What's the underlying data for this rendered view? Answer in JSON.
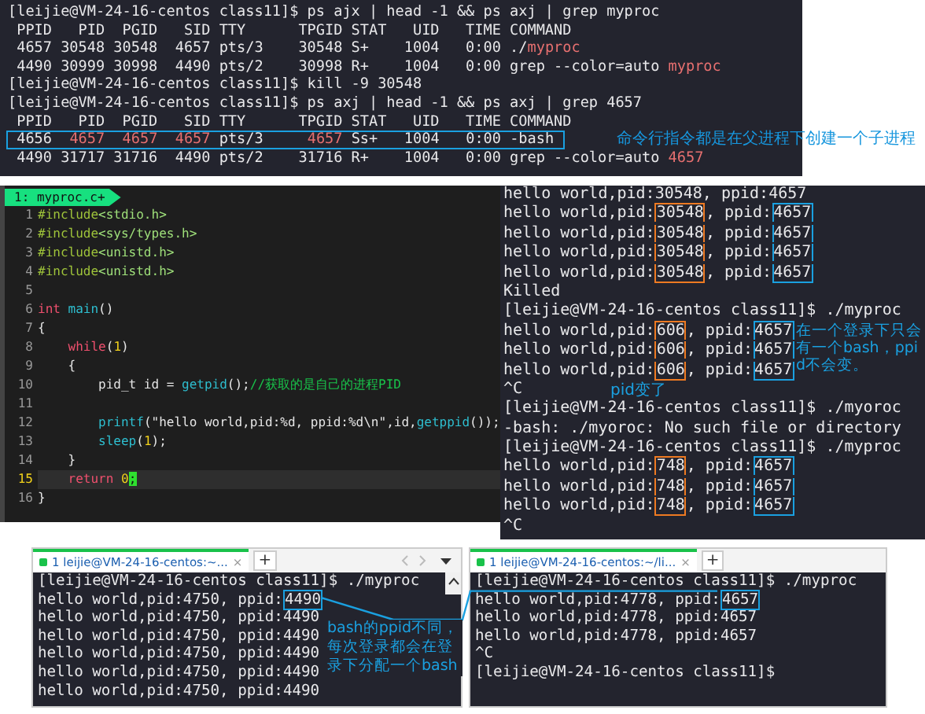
{
  "top_terminal": {
    "lines": [
      {
        "highlighted": false,
        "segments": [
          {
            "text": "[leijie@VM-24-16-centos class11]$ ps ajx | head -1 && ps axj | grep myproc",
            "kind": "plain"
          }
        ]
      },
      {
        "highlighted": false,
        "segments": [
          {
            "text": " PPID   PID  PGID   SID TTY      TPGID STAT   UID   TIME COMMAND",
            "kind": "plain"
          }
        ]
      },
      {
        "highlighted": false,
        "segments": [
          {
            "text": " 4657 30548 30548  4657 pts/3    30548 S+    1004   0:00 ./",
            "kind": "plain"
          },
          {
            "text": "myproc",
            "kind": "match"
          }
        ]
      },
      {
        "highlighted": false,
        "segments": [
          {
            "text": " 4490 30999 30998  4490 pts/2    30998 R+    1004   0:00 grep --color=auto ",
            "kind": "plain"
          },
          {
            "text": "myproc",
            "kind": "match"
          }
        ]
      },
      {
        "highlighted": false,
        "segments": [
          {
            "text": "[leijie@VM-24-16-centos class11]$ kill -9 30548",
            "kind": "plain"
          }
        ]
      },
      {
        "highlighted": false,
        "segments": [
          {
            "text": "[leijie@VM-24-16-centos class11]$ ps axj | head -1 && ps axj | grep 4657",
            "kind": "plain"
          }
        ]
      },
      {
        "highlighted": false,
        "segments": [
          {
            "text": " PPID   PID  PGID   SID TTY      TPGID STAT   UID   TIME COMMAND",
            "kind": "plain"
          }
        ]
      },
      {
        "highlighted": true,
        "segments": [
          {
            "text": " 4656  ",
            "kind": "plain"
          },
          {
            "text": "4657",
            "kind": "match"
          },
          {
            "text": "  4657",
            "kind": "match"
          },
          {
            "text": "  4657",
            "kind": "match"
          },
          {
            "text": " pts/3     ",
            "kind": "plain"
          },
          {
            "text": "4657",
            "kind": "match"
          },
          {
            "text": " Ss+   1004   0:00 -bash ",
            "kind": "plain"
          }
        ]
      },
      {
        "highlighted": false,
        "segments": [
          {
            "text": " 4490 31717 31716  4490 pts/2    31716 R+    1004   0:00 grep --color=auto ",
            "kind": "plain"
          },
          {
            "text": "4657",
            "kind": "match"
          }
        ]
      }
    ],
    "annotation": "命令行指令都是在父进程下创建一个子进程"
  },
  "editor": {
    "tab": "1: myproc.c+",
    "lines": [
      {
        "number": "1",
        "current": false,
        "segments": [
          {
            "text": "#include",
            "kind": "preproc"
          },
          {
            "text": "<stdio.h>",
            "kind": "header"
          }
        ]
      },
      {
        "number": "2",
        "current": false,
        "segments": [
          {
            "text": "#include",
            "kind": "preproc"
          },
          {
            "text": "<sys/types.h>",
            "kind": "header"
          }
        ]
      },
      {
        "number": "3",
        "current": false,
        "segments": [
          {
            "text": "#include",
            "kind": "preproc"
          },
          {
            "text": "<unistd.h>",
            "kind": "header"
          }
        ]
      },
      {
        "number": "4",
        "current": false,
        "segments": [
          {
            "text": "#include",
            "kind": "preproc"
          },
          {
            "text": "<unistd.h>",
            "kind": "header"
          }
        ]
      },
      {
        "number": "5",
        "current": false
      },
      {
        "number": "6",
        "current": false,
        "segments": [
          {
            "text": "int",
            "kind": "keyword"
          },
          {
            "text": " main",
            "kind": "func"
          },
          {
            "text": "()",
            "kind": "plain"
          }
        ]
      },
      {
        "number": "7",
        "current": false,
        "segments": [
          {
            "text": "{",
            "kind": "plain"
          }
        ]
      },
      {
        "number": "8",
        "current": false,
        "segments": [
          {
            "text": "    while",
            "kind": "keyword"
          },
          {
            "text": "(",
            "kind": "plain"
          },
          {
            "text": "1",
            "kind": "number"
          },
          {
            "text": ")",
            "kind": "plain"
          }
        ]
      },
      {
        "number": "9",
        "current": false,
        "segments": [
          {
            "text": "    {",
            "kind": "plain"
          }
        ]
      },
      {
        "number": "10",
        "current": false,
        "segments": [
          {
            "text": "        pid_t id = ",
            "kind": "plain"
          },
          {
            "text": "getpid",
            "kind": "func"
          },
          {
            "text": "();",
            "kind": "plain"
          },
          {
            "text": "//获取的是自己的进程PID",
            "kind": "comment"
          }
        ]
      },
      {
        "number": "11",
        "current": false
      },
      {
        "number": "12",
        "current": false,
        "segments": [
          {
            "text": "        printf",
            "kind": "func"
          },
          {
            "text": "(\"hello world,pid:%d, ppid:%d\\n\",id,",
            "kind": "plain"
          },
          {
            "text": "getppid",
            "kind": "func"
          },
          {
            "text": "());",
            "kind": "plain"
          }
        ]
      },
      {
        "number": "13",
        "current": false,
        "segments": [
          {
            "text": "        sleep",
            "kind": "func"
          },
          {
            "text": "(",
            "kind": "plain"
          },
          {
            "text": "1",
            "kind": "number"
          },
          {
            "text": ");",
            "kind": "plain"
          }
        ]
      },
      {
        "number": "14",
        "current": false,
        "segments": [
          {
            "text": "    }",
            "kind": "plain"
          }
        ]
      },
      {
        "number": "15",
        "current": true,
        "segments": [
          {
            "text": "    return",
            "kind": "keyword"
          },
          {
            "text": " 0",
            "kind": "number"
          },
          {
            "text": ";",
            "kind": "cursor"
          }
        ]
      },
      {
        "number": "16",
        "current": false,
        "segments": [
          {
            "text": "}",
            "kind": "plain"
          }
        ]
      }
    ]
  },
  "right_terminal": {
    "lines": [
      {
        "segments": [
          {
            "text": "hello world,pid:30548, ppid:4657",
            "kind": "plain"
          }
        ]
      },
      {
        "segments": [
          {
            "text": "hello world,pid:",
            "kind": "plain"
          },
          {
            "text": "30548",
            "kind": "pid_box"
          },
          {
            "text": ", ppid:",
            "kind": "plain"
          },
          {
            "text": "4657",
            "kind": "ppid_box"
          }
        ]
      },
      {
        "segments": [
          {
            "text": "hello world,pid:",
            "kind": "plain"
          },
          {
            "text": "30548",
            "kind": "pid_box"
          },
          {
            "text": ", ppid:",
            "kind": "plain"
          },
          {
            "text": "4657",
            "kind": "ppid_box"
          }
        ]
      },
      {
        "segments": [
          {
            "text": "hello world,pid:",
            "kind": "plain"
          },
          {
            "text": "30548",
            "kind": "pid_box"
          },
          {
            "text": ", ppid:",
            "kind": "plain"
          },
          {
            "text": "4657",
            "kind": "ppid_box"
          }
        ]
      },
      {
        "segments": [
          {
            "text": "hello world,pid:",
            "kind": "plain"
          },
          {
            "text": "30548",
            "kind": "pid_box"
          },
          {
            "text": ", ppid:",
            "kind": "plain"
          },
          {
            "text": "4657",
            "kind": "ppid_box"
          }
        ]
      },
      {
        "segments": [
          {
            "text": "Killed",
            "kind": "plain"
          }
        ]
      },
      {
        "segments": [
          {
            "text": "[leijie@VM-24-16-centos class11]$ ./myproc",
            "kind": "plain"
          }
        ]
      },
      {
        "segments": [
          {
            "text": "hello world,pid:",
            "kind": "plain"
          },
          {
            "text": "606",
            "kind": "pid_box"
          },
          {
            "text": ", ppid:",
            "kind": "plain"
          },
          {
            "text": "4657",
            "kind": "ppid_box"
          }
        ]
      },
      {
        "segments": [
          {
            "text": "hello world,pid:",
            "kind": "plain"
          },
          {
            "text": "606",
            "kind": "pid_box"
          },
          {
            "text": ", ppid:",
            "kind": "plain"
          },
          {
            "text": "4657",
            "kind": "ppid_box"
          }
        ]
      },
      {
        "segments": [
          {
            "text": "hello world,pid:",
            "kind": "plain"
          },
          {
            "text": "606",
            "kind": "pid_box"
          },
          {
            "text": ", ppid:",
            "kind": "plain"
          },
          {
            "text": "4657",
            "kind": "ppid_box"
          }
        ]
      },
      {
        "segments": [
          {
            "text": "^C",
            "kind": "plain"
          }
        ]
      },
      {
        "segments": [
          {
            "text": "[leijie@VM-24-16-centos class11]$ ./myoroc",
            "kind": "plain"
          }
        ]
      },
      {
        "segments": [
          {
            "text": "-bash: ./myoroc: No such file or directory",
            "kind": "plain"
          }
        ]
      },
      {
        "segments": [
          {
            "text": "[leijie@VM-24-16-centos class11]$ ./myproc",
            "kind": "plain"
          }
        ]
      },
      {
        "segments": [
          {
            "text": "hello world,pid:",
            "kind": "plain"
          },
          {
            "text": "748",
            "kind": "pid_box"
          },
          {
            "text": ", ppid:",
            "kind": "plain"
          },
          {
            "text": "4657",
            "kind": "ppid_box"
          }
        ]
      },
      {
        "segments": [
          {
            "text": "hello world,pid:",
            "kind": "plain"
          },
          {
            "text": "748",
            "kind": "pid_box"
          },
          {
            "text": ", ppid:",
            "kind": "plain"
          },
          {
            "text": "4657",
            "kind": "ppid_box"
          }
        ]
      },
      {
        "segments": [
          {
            "text": "hello world,pid:",
            "kind": "plain"
          },
          {
            "text": "748",
            "kind": "pid_box"
          },
          {
            "text": ", ppid:",
            "kind": "plain"
          },
          {
            "text": "4657",
            "kind": "ppid_box"
          }
        ]
      },
      {
        "segments": [
          {
            "text": "^C",
            "kind": "plain"
          }
        ]
      }
    ],
    "annotations": [
      "pid变了",
      "在一个登录下只会有一个bash，ppid不会变。"
    ]
  },
  "bottom_windows": [
    {
      "tab": "1 leijie@VM-24-16-centos:~...",
      "close": "×",
      "new_tab": "+",
      "lines": [
        {
          "segments": [
            {
              "text": "[leijie@VM-24-16-centos class11]$ ./myproc",
              "kind": "plain"
            }
          ]
        },
        {
          "segments": [
            {
              "text": "hello world,pid:4750, ppid:",
              "kind": "plain"
            },
            {
              "text": "4490",
              "kind": "ppid_box"
            }
          ]
        },
        {
          "segments": [
            {
              "text": "hello world,pid:4750, ppid:4490",
              "kind": "plain"
            }
          ]
        },
        {
          "segments": [
            {
              "text": "hello world,pid:4750, ppid:4490",
              "kind": "plain"
            }
          ]
        },
        {
          "segments": [
            {
              "text": "hello world,pid:4750, ppid:4490",
              "kind": "plain"
            }
          ]
        },
        {
          "segments": [
            {
              "text": "hello world,pid:4750, ppid:4490",
              "kind": "plain"
            }
          ]
        },
        {
          "segments": [
            {
              "text": "hello world,pid:4750, ppid:4490",
              "kind": "plain"
            }
          ]
        }
      ]
    },
    {
      "tab": "1 leijie@VM-24-16-centos:~/li...",
      "close": "×",
      "new_tab": "+",
      "lines": [
        {
          "segments": [
            {
              "text": "[leijie@VM-24-16-centos class11]$ ./myproc",
              "kind": "plain"
            }
          ]
        },
        {
          "segments": [
            {
              "text": "hello world,pid:4778, ppid:",
              "kind": "plain"
            },
            {
              "text": "4657",
              "kind": "ppid_box"
            }
          ]
        },
        {
          "segments": [
            {
              "text": "hello world,pid:4778, ppid:4657",
              "kind": "plain"
            }
          ]
        },
        {
          "segments": [
            {
              "text": "hello world,pid:4778, ppid:4657",
              "kind": "plain"
            }
          ]
        },
        {
          "segments": [
            {
              "text": "^C",
              "kind": "plain"
            }
          ]
        },
        {
          "segments": [
            {
              "text": "[leijie@VM-24-16-centos class11]$",
              "kind": "plain"
            }
          ]
        }
      ]
    }
  ],
  "bottom_annotation": "bash的ppid不同，每次登录都会在登录下分配一个bash"
}
